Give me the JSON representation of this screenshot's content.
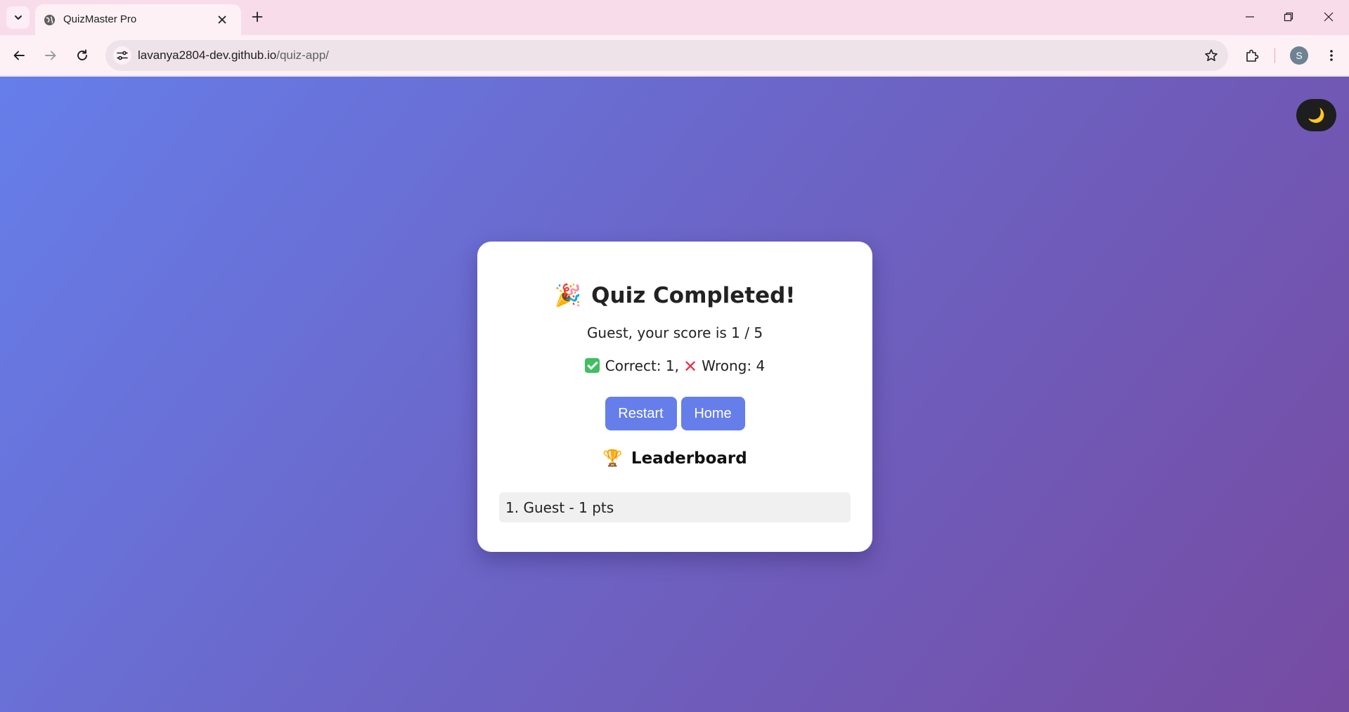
{
  "browser": {
    "tab_title": "QuizMaster Pro",
    "url_domain": "lavanya2804-dev.github.io",
    "url_path": "/quiz-app/",
    "profile_initial": "S"
  },
  "theme_toggle": {
    "icon": "moon-icon",
    "glyph": "🌙"
  },
  "result": {
    "title_emoji": "🎉",
    "title": "Quiz Completed!",
    "score_text": "Guest, your score is 1 / 5",
    "correct_label": "Correct: 1,",
    "wrong_label": "Wrong: 4",
    "restart_label": "Restart",
    "home_label": "Home"
  },
  "leaderboard": {
    "title_emoji": "🏆",
    "title": "Leaderboard",
    "entries": [
      {
        "text": "1. Guest - 1 pts"
      }
    ]
  },
  "colors": {
    "gradient_start": "#667eea",
    "gradient_end": "#764ba2",
    "button": "#667eea",
    "toggle_bg": "#1e1e1e"
  }
}
